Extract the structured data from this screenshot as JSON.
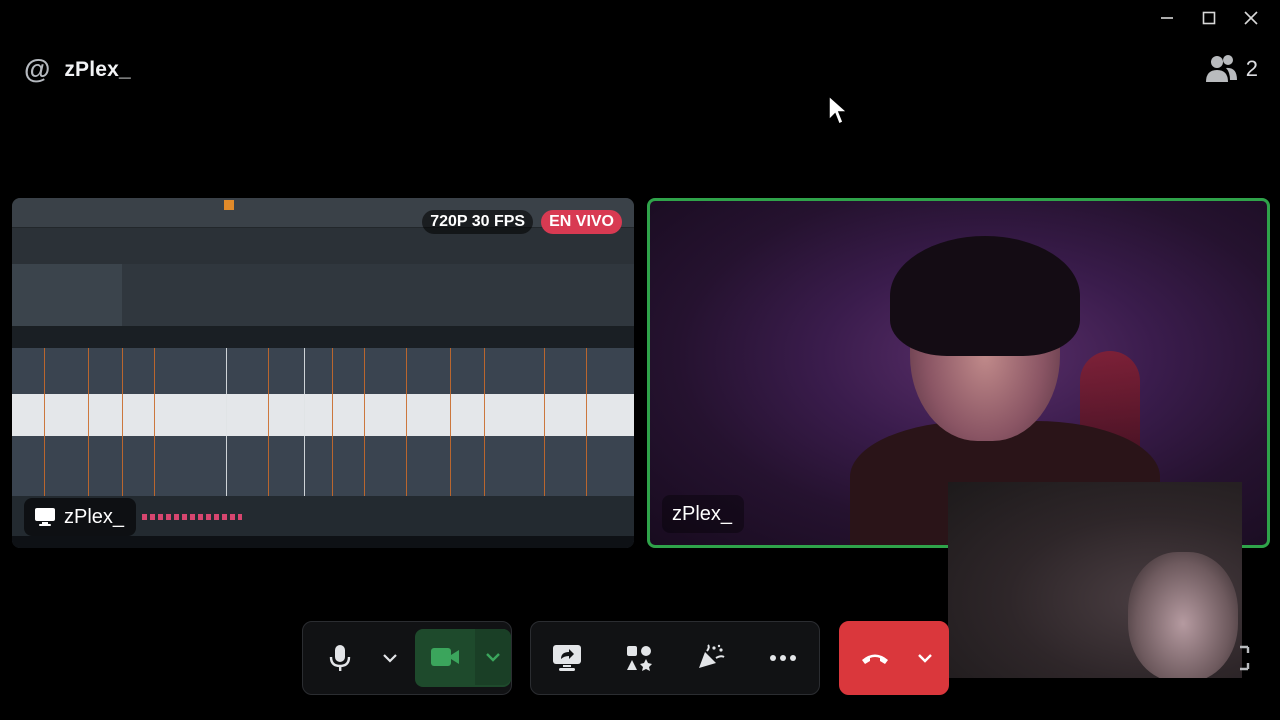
{
  "window": {
    "controls": [
      "minimize",
      "maximize",
      "close"
    ]
  },
  "header": {
    "at_symbol": "@",
    "channel_name": "zPlex_",
    "participant_count": "2",
    "participants_icon": "people-icon"
  },
  "screen_share": {
    "quality_badge": "720P 30 FPS",
    "live_badge": "EN VIVO",
    "owner_name": "zPlex_",
    "owner_icon": "screen-icon",
    "colors": {
      "live": "#d83a52",
      "waveform": "#e4e7ea",
      "marker": "#c86a2a"
    }
  },
  "camera": {
    "owner_name": "zPlex_",
    "speaking_border": "#2fa34a"
  },
  "controls": {
    "mic_icon": "microphone-icon",
    "mic_options_icon": "chevron-down-icon",
    "camera_icon": "video-camera-icon",
    "camera_options_icon": "chevron-down-icon",
    "share_screen_icon": "share-screen-icon",
    "activities_icon": "activities-icon",
    "soundboard_icon": "soundboard-icon",
    "more_icon": "more-icon",
    "disconnect_icon": "hang-up-icon",
    "disconnect_options_icon": "chevron-down-icon",
    "fullscreen_icon": "fullscreen-icon",
    "colors": {
      "camera_on": "#1e4a2c",
      "disconnect": "#da373c"
    }
  }
}
